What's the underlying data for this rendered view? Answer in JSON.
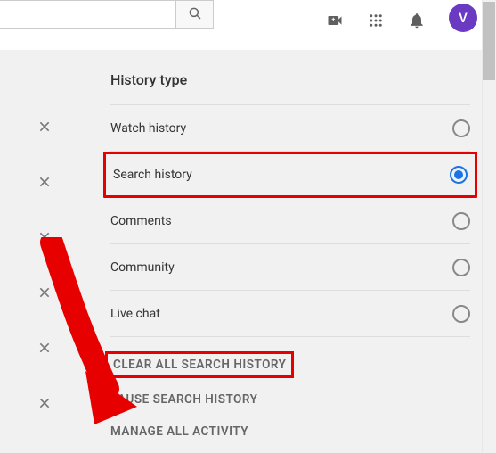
{
  "topbar": {
    "search_placeholder": "",
    "avatar_initial": "V"
  },
  "panel": {
    "title": "History type",
    "options": [
      {
        "label": "Watch history",
        "selected": false
      },
      {
        "label": "Search history",
        "selected": true
      },
      {
        "label": "Comments",
        "selected": false
      },
      {
        "label": "Community",
        "selected": false
      },
      {
        "label": "Live chat",
        "selected": false
      }
    ],
    "actions": {
      "clear": "CLEAR ALL SEARCH HISTORY",
      "pause": "PAUSE SEARCH HISTORY",
      "manage": "MANAGE ALL ACTIVITY"
    }
  },
  "colors": {
    "highlight": "#e60000",
    "accent": "#1a73e8",
    "avatar_bg": "#6b3ac2"
  }
}
